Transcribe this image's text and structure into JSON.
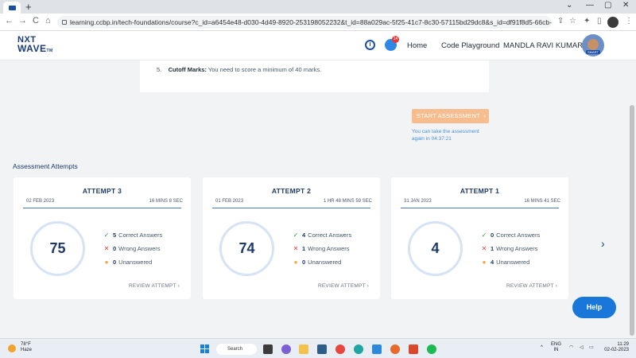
{
  "browser": {
    "new_tab": "+",
    "url": "learning.ccbp.in/tech-foundations/course?c_id=a6454e48-d030-4d49-8920-253198052232&t_id=88a029ac-5f25-41c7-8c30-57115bd29dc8&s_id=df91f8d5-66cb-47ac-853b-1f47f...",
    "back": "←",
    "forward": "→",
    "reload": "C",
    "home": "⌂",
    "minimize": "—",
    "maximize": "▢",
    "close": "✕",
    "chevron": "⌄"
  },
  "header": {
    "logo_line1": "NXT",
    "logo_line2": "WAVE",
    "logo_tm": "TM",
    "notification_count": "14",
    "nav": {
      "home": "Home",
      "code_playground": "Code Playground",
      "user_name": "MANDLA RAVI KUMAR"
    },
    "avatar_tag": "SMART"
  },
  "instructions": {
    "number": "5.",
    "label": "Cutoff Marks:",
    "text": "You need to score a minimum of 40 marks."
  },
  "start": {
    "button_label": "START ASSESSMENT",
    "button_chevron": "›",
    "note_line1": "You can take the assessment",
    "note_line2": "again in 04:37:21"
  },
  "attempts_section_title": "Assessment Attempts",
  "attempts": [
    {
      "title": "ATTEMPT 3",
      "date": "02 FEB 2023",
      "duration": "16 MINS 8 SEC",
      "score": "75",
      "correct": "5",
      "correct_label": "Correct Answers",
      "wrong": "0",
      "wrong_label": "Wrong Answers",
      "unanswered": "0",
      "unanswered_label": "Unanswered",
      "review": "REVIEW ATTEMPT ›"
    },
    {
      "title": "ATTEMPT 2",
      "date": "01 FEB 2023",
      "duration": "1 HR 48 MINS 59 SEC",
      "score": "74",
      "correct": "4",
      "correct_label": "Correct Answers",
      "wrong": "1",
      "wrong_label": "Wrong Answers",
      "unanswered": "0",
      "unanswered_label": "Unanswered",
      "review": "REVIEW ATTEMPT ›"
    },
    {
      "title": "ATTEMPT 1",
      "date": "31 JAN 2023",
      "duration": "16 MINS 41 SEC",
      "score": "4",
      "correct": "0",
      "correct_label": "Correct Answers",
      "wrong": "1",
      "wrong_label": "Wrong Answers",
      "unanswered": "4",
      "unanswered_label": "Unanswered",
      "review": "REVIEW ATTEMPT ›"
    }
  ],
  "icons": {
    "check": "✓",
    "cross": "✕",
    "dot": "●",
    "next": "›"
  },
  "help_label": "Help",
  "taskbar": {
    "temp": "78°F",
    "weather": "Haze",
    "search": "Search",
    "lang_line1": "ENG",
    "lang_line2": "IN",
    "time": "11:29",
    "date": "02-02-2023",
    "tray_chevron": "^"
  },
  "colors": {
    "accent": "#1e3a6a",
    "start_button": "#f7bd8e",
    "help": "#1877d8",
    "correct": "#22a05a",
    "wrong": "#e53935",
    "unanswered": "#f2a33a"
  }
}
